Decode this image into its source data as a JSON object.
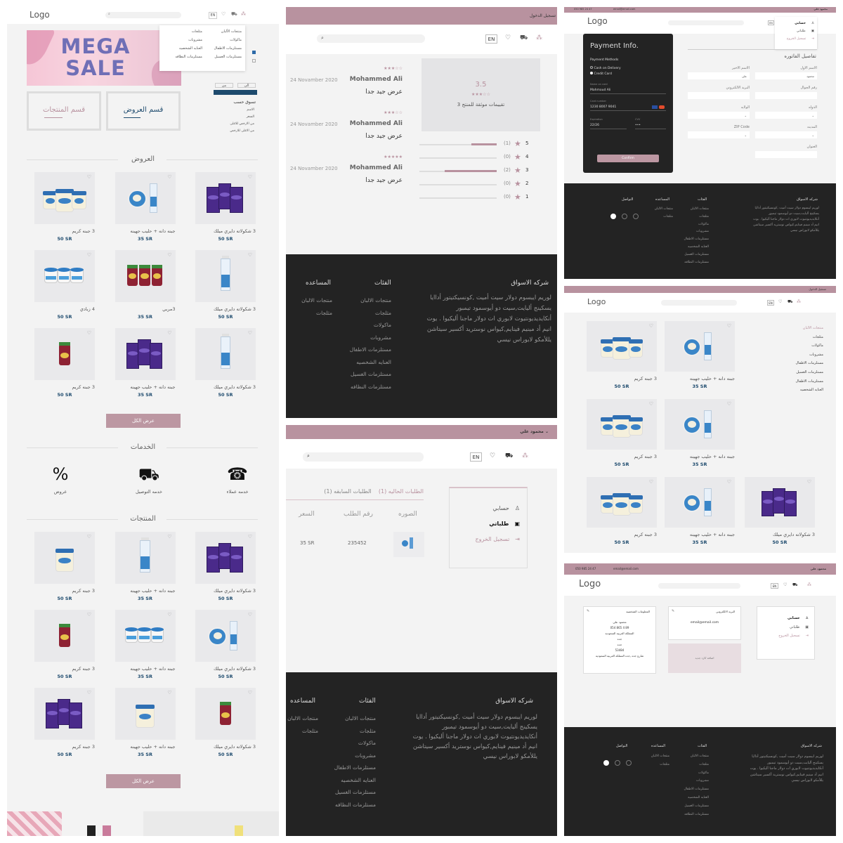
{
  "home": {
    "logo": "Logo",
    "lang": "EN",
    "sale_banner": "MEGA SALE",
    "dropdown_items": [
      "منتجات الألبان",
      "مثلجات",
      "ماكولات",
      "مشروبات",
      "مستلزمات الاطفال",
      "العنايه الشخصيه",
      "مستلزمات الغسيل",
      "مستلزمات النظافه"
    ],
    "side_filter_title": "تسوق حسب",
    "side_filter_items": [
      "الاسم",
      "السعر",
      "من الارخص للاغلى",
      "من الاغلى للارخص"
    ],
    "side_price_from": "من",
    "side_price_to": "الى",
    "side_price_btn": "",
    "offers_box": "قسم العروض",
    "products_box": "قسم المنتجات",
    "offers_title": "العروض",
    "offers": [
      {
        "title": "3 شكولاته دايري ميلك",
        "price": "50 SR",
        "kind": "dairymilk"
      },
      {
        "title": "جبنه دانه + حليب جهينه",
        "price": "35 SR",
        "kind": "cheese"
      },
      {
        "title": "3 جبنه كريم",
        "price": "50 SR",
        "kind": "jars"
      },
      {
        "title": "3 شكولاته دايري ميلك",
        "price": "50 SR",
        "kind": "milk"
      },
      {
        "title": "3مربي",
        "price": "35 SR",
        "kind": "jam"
      },
      {
        "title": "4 زبادي",
        "price": "50 SR",
        "kind": "yogurt"
      },
      {
        "title": "3 شكولاته دايري ميلك",
        "price": "50 SR",
        "kind": "milk"
      },
      {
        "title": "جبنه دانه + حليب جهينه",
        "price": "35 SR",
        "kind": "dairymilk"
      },
      {
        "title": "3 جبنه كريم",
        "price": "50 SR",
        "kind": "jamjar"
      }
    ],
    "view_all": "عرض الكل",
    "services_title": "الخدمات",
    "services": [
      {
        "label": "خدمه عملاء",
        "icon": "headset-icon",
        "glyph": "☎"
      },
      {
        "label": "خدمه التوصيل",
        "icon": "truck-icon",
        "glyph": "⛟"
      },
      {
        "label": "عروض",
        "icon": "discount-icon",
        "glyph": "%"
      }
    ],
    "products_title": "المنتجات",
    "products": [
      {
        "title": "3 شكولاته دايري ميلك",
        "price": "50 SR",
        "kind": "dairymilk"
      },
      {
        "title": "جبنه دانه + حليب جهينه",
        "price": "35 SR",
        "kind": "milk"
      },
      {
        "title": "3 جبنه كريم",
        "price": "50 SR",
        "kind": "jar"
      },
      {
        "title": "3 شكولاته دايري ميلك",
        "price": "50 SR",
        "kind": "cheese"
      },
      {
        "title": "جبنه دانه + حليب جهينه",
        "price": "35 SR",
        "kind": "yogurt"
      },
      {
        "title": "3 جبنه كريم",
        "price": "50 SR",
        "kind": "jamjar"
      },
      {
        "title": "3 شكولاته دايري ميلك",
        "price": "50 SR",
        "kind": "jamjar"
      },
      {
        "title": "جبنه دانه + حليب جهينه",
        "price": "35 SR",
        "kind": "jar"
      },
      {
        "title": "3 جبنه كريم",
        "price": "50 SR",
        "kind": "dairymilk"
      }
    ],
    "view_all_2": "عرض الكل"
  },
  "reviews": {
    "topbar": "تسجيل الدخول",
    "lang": "EN",
    "rating": "3.5",
    "rating_caption": "3 تقييمات موثقة للمنتج",
    "bars": [
      {
        "star": "5",
        "count": "(1)",
        "fill": 0.33
      },
      {
        "star": "4",
        "count": "(0)",
        "fill": 0
      },
      {
        "star": "3",
        "count": "(2)",
        "fill": 0.67
      },
      {
        "star": "2",
        "count": "(0)",
        "fill": 0
      },
      {
        "star": "1",
        "count": "(0)",
        "fill": 0
      }
    ],
    "items": [
      {
        "name": "Mohammed Ali",
        "date": "24 Novamber 2020",
        "text": "عرض جيد جدا",
        "stars": "★★★☆☆"
      },
      {
        "name": "Mohammed Ali",
        "date": "24 Novamber 2020",
        "text": "عرض جيد جدا",
        "stars": "★★★☆☆"
      },
      {
        "name": "Mohammed Ali",
        "date": "24 Novamber 2020",
        "text": "عرض جيد جدا",
        "stars": "★★★★★"
      }
    ]
  },
  "footer": {
    "company_title": "شركه الاسواق",
    "company_text": "لوريم ايبسوم دولار سيت أميت ,كونسيكتيتور أداايا يسكينج أليايت,سيت دو أيوسمود تيمبور أنكايديديونتيوت لابوري ات دولار ماجنا أليكيوا . يوت انيم أد مينيم فينايم,كيواس نوستريد أكسير سيتاشن يللأمكو لابوراس نيسي",
    "cat_title": "الفئات",
    "cats": [
      "منتجات الالبان",
      "مثلجات",
      "ماكولات",
      "مشروبات",
      "مستلزمات الاطفال",
      "العنايه الشخصيه",
      "مستلزمات الغسيل",
      "مستلزمات النظافه"
    ],
    "help_title": "المساعده",
    "help_items": [
      "منتجات الالبان",
      "مثلجات"
    ],
    "contact_title": "التواصل"
  },
  "orders": {
    "user": "محمود علي",
    "lang": "EN",
    "tab_current": "الطلبات الحاليه",
    "tab_current_count": "(1)",
    "tab_prev": "الطلبات السابقه",
    "tab_prev_count": "(1)",
    "col_image": "الصوره",
    "col_order": "رقم الطلب",
    "col_price": "السعر",
    "row_order": "235452",
    "row_price": "35 SR",
    "menu": [
      "حسابي",
      "طلباتي",
      "تسجيل الخروج"
    ]
  },
  "payment": {
    "phone": "050 985 24 47",
    "email": "email@email.com",
    "user": "محمود علي",
    "logo": "Logo",
    "lang": "EN",
    "card_title": "Payment Info.",
    "methods_label": "Payment Methods",
    "cod": "Cash on Delivery",
    "credit": "Credit Card",
    "name_label": "Name on card",
    "name_value": "Mahmoud Ali",
    "num_label": "Card number",
    "num_value": "1230 8007 9041",
    "exp_label": "Expiration",
    "exp_value": "22/26",
    "cvv_label": "CVV",
    "cvv_value": "•••",
    "confirm": "Confirm",
    "menu": [
      "حسابي",
      "طلباتي",
      "تسجيل الخروج"
    ],
    "billing_title": "تفاصيل الفاتوره",
    "first": "الاسم الاول",
    "first_val": "محمود",
    "last": "الاسم الاخير",
    "last_val": "علي",
    "mobile": "رقم الجوال",
    "mail": "البريد الالكتروني",
    "country": "الدوله",
    "state": "الولايه",
    "city": "المدينه",
    "zip": "ZIP Code",
    "address": "العنوان"
  },
  "category": {
    "topbar": "تسجيل الدخول",
    "logo": "Logo",
    "lang": "EN",
    "sidebar": [
      "منتجات الالبان",
      "مثلجات",
      "ماكولات",
      "مشروبات",
      "مستلزمات الاطفال",
      "مستلزمات الغسيل",
      "مستلزمات الاطفال",
      "العنايه الشخصيه"
    ],
    "items": [
      {
        "title": "3 جبنه كريم",
        "price": "50 SR",
        "kind": "jars"
      },
      {
        "title": "جبنه دانه + حليب جهينه",
        "price": "35 SR",
        "kind": "cheese"
      },
      {
        "title": "3 جبنه كريم",
        "price": "50 SR",
        "kind": "jars"
      },
      {
        "title": "جبنه دانه + حليب جهينه",
        "price": "35 SR",
        "kind": "cheese"
      },
      {
        "title": "3 جبنه كريم",
        "price": "50 SR",
        "kind": "jars"
      },
      {
        "title": "جبنه دانه + حليب جهينه",
        "price": "35 SR",
        "kind": "cheese"
      },
      {
        "title": "3 شكولاته دايري ميلك",
        "price": "50 SR",
        "kind": "dairymilk"
      }
    ]
  },
  "account": {
    "phone": "050 985 24 47",
    "email": "email@email.com",
    "user": "محمود علي",
    "logo": "Logo",
    "lang": "EN",
    "menu": [
      "حسابي",
      "طلباتي",
      "تسجيل الخروج"
    ],
    "email_card_title": "البريد الالكتروني",
    "email_value": "email@email.com",
    "info_card_title": "المعلومات الشخصيه",
    "info_lines": [
      "محمود علي",
      "054 865 4 89",
      "المملكه العربيه السعوديه",
      "جده",
      "جده",
      "53484",
      "شارع جده ,جده المملكه العربيه السعوديه"
    ],
    "add_card": "اضافه كارد جديد"
  }
}
